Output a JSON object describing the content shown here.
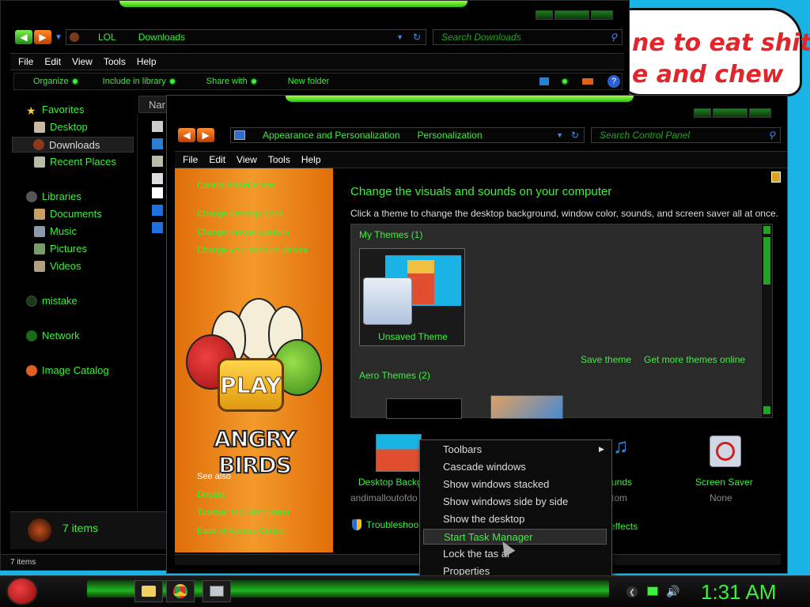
{
  "background_ad": {
    "line1": "ne to eat shit",
    "line2": "e and chew"
  },
  "explorer": {
    "breadcrumb": [
      "LOL",
      "Downloads"
    ],
    "search_placeholder": "Search Downloads",
    "menu": [
      "File",
      "Edit",
      "View",
      "Tools",
      "Help"
    ],
    "commands": [
      "Organize",
      "Include in library",
      "Share with",
      "New folder"
    ],
    "column_header": "Nar",
    "nav": {
      "favorites": "Favorites",
      "desktop": "Desktop",
      "downloads": "Downloads",
      "recent": "Recent Places",
      "libraries": "Libraries",
      "documents": "Documents",
      "music": "Music",
      "pictures": "Pictures",
      "videos": "Videos",
      "mistake": "mistake",
      "network": "Network",
      "image_catalog": "Image Catalog"
    },
    "details_count": "7 items",
    "status_count": "7 items"
  },
  "control_panel": {
    "breadcrumb": [
      "Appearance and Personalization",
      "Personalization"
    ],
    "search_placeholder": "Search Control Panel",
    "menu": [
      "File",
      "Edit",
      "View",
      "Tools",
      "Help"
    ],
    "sidebar": {
      "home": "Control Panel Home",
      "links": [
        "Change desktop icons",
        "Change mouse pointers",
        "Change your account picture"
      ],
      "see_also": "See also",
      "see_also_links": [
        "Display",
        "Taskbar and Start Menu",
        "Ease of Access Center"
      ]
    },
    "heading": "Change the visuals and sounds on your computer",
    "subheading": "Click a theme to change the desktop background, window color, sounds, and screen saver all at once.",
    "my_themes": "My Themes (1)",
    "unsaved_theme": "Unsaved Theme",
    "save_theme": "Save theme",
    "get_more": "Get more themes online",
    "aero_themes": "Aero Themes (2)",
    "bottom": {
      "desktop_bg_label": "Desktop Backg",
      "desktop_bg_sub": "andimalloutofdo",
      "sounds_label": "unds",
      "sounds_sub": "tom",
      "screensaver_label": "Screen Saver",
      "screensaver_sub": "None",
      "troubleshoot": "Troubleshoo",
      "effects": "effects"
    }
  },
  "poster": {
    "play": "PLAY",
    "title": "ANGRY BIRDS"
  },
  "context_menu": {
    "items": [
      "Toolbars",
      "Cascade windows",
      "Show windows stacked",
      "Show windows side by side",
      "Show the desktop",
      "Start Task Manager",
      "Lock the tas    ar",
      "Properties"
    ],
    "highlighted_index": 5
  },
  "taskbar": {
    "clock": "1:31 AM"
  },
  "colors": {
    "accent_green": "#3cf03c",
    "orange": "#f08a1e",
    "bg_blue": "#1ab3e6"
  }
}
